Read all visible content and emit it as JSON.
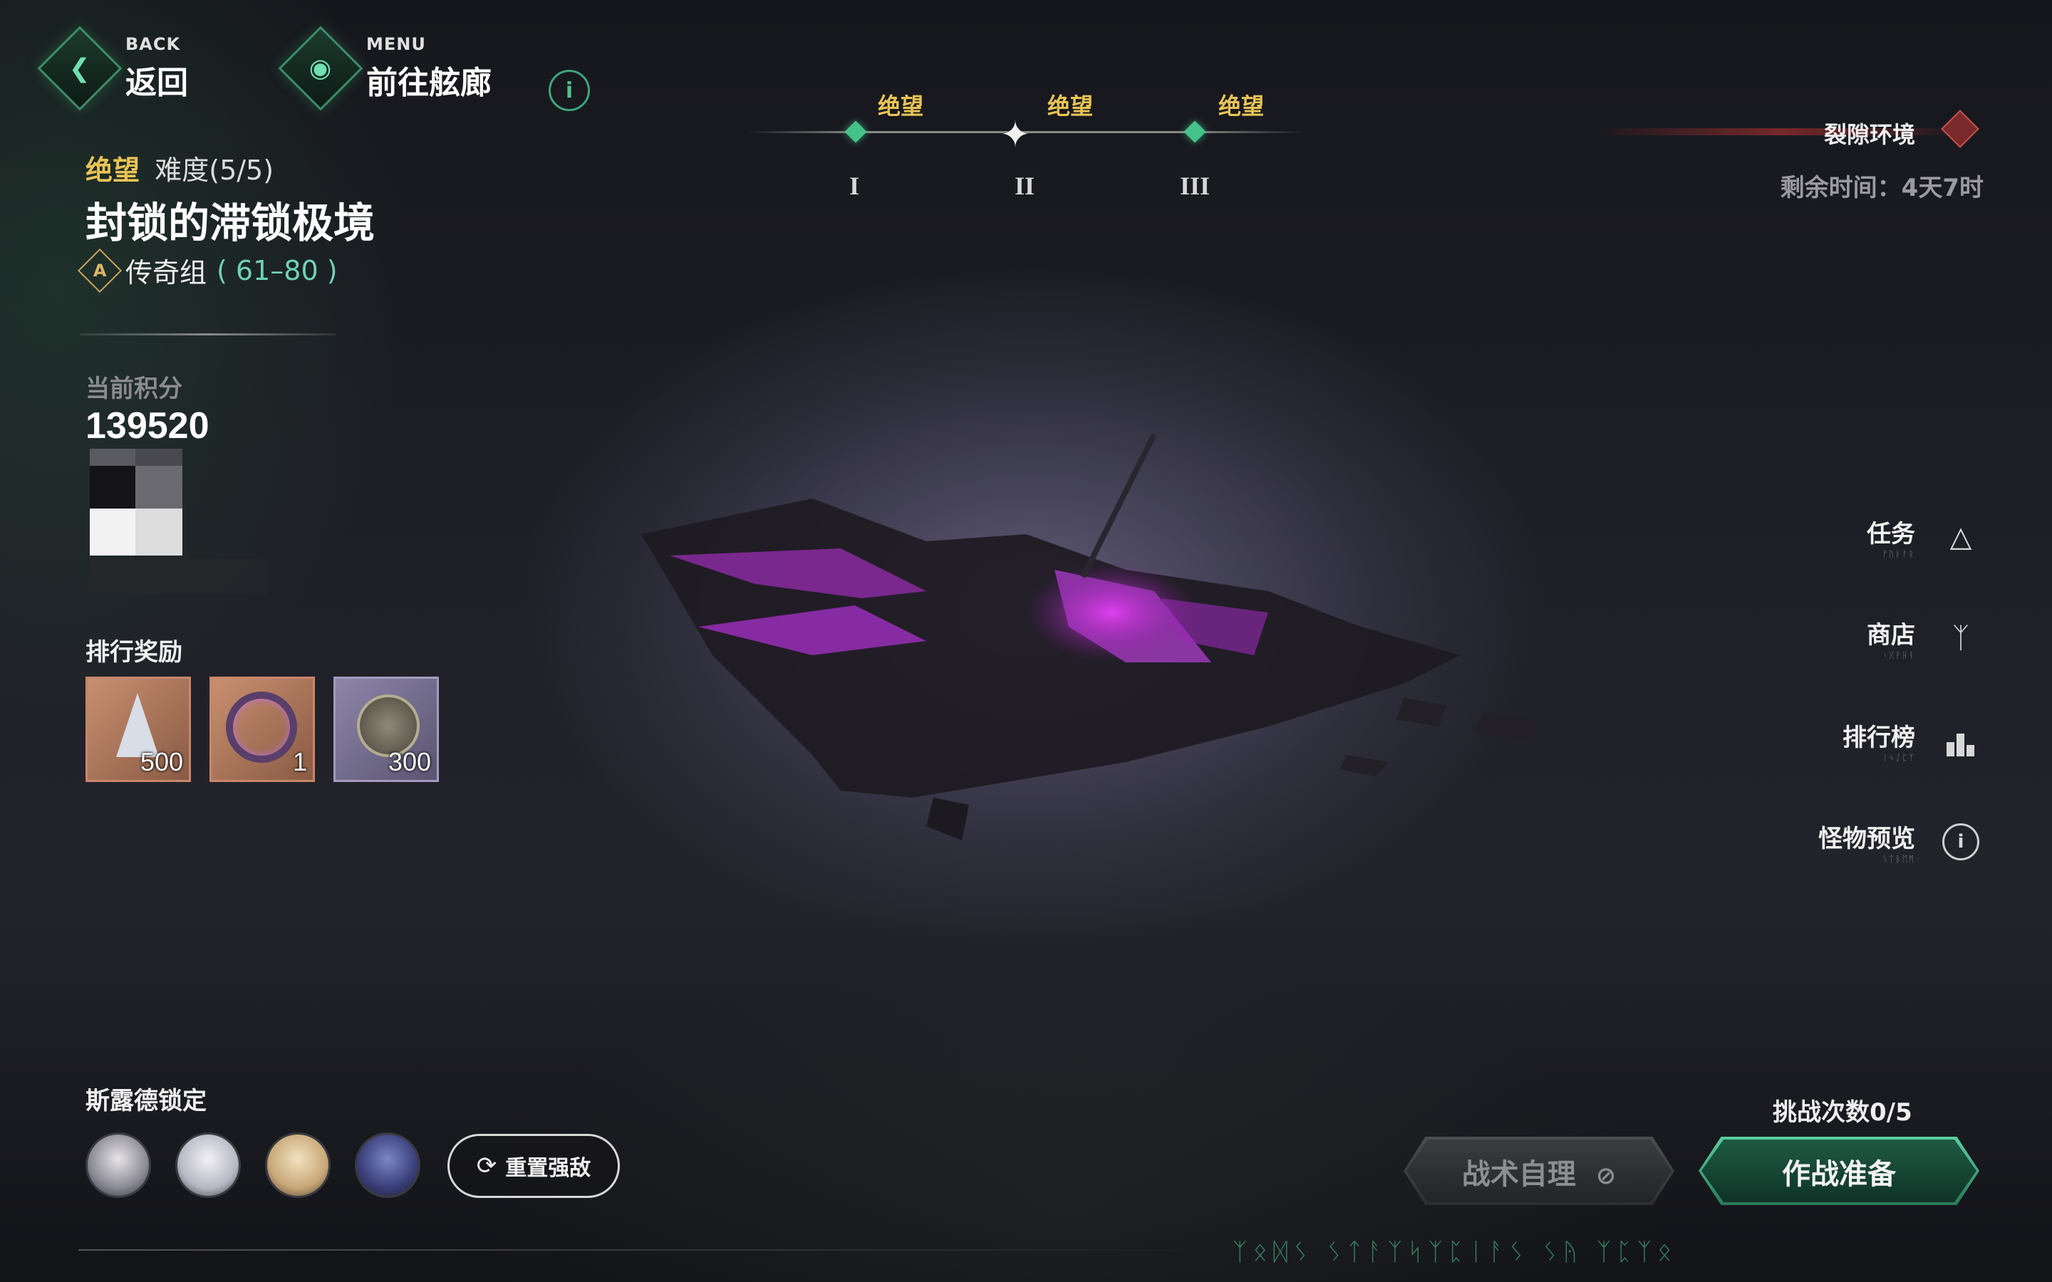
{
  "nav": {
    "back_small": "BACK",
    "back_label": "返回",
    "menu_small": "MENU",
    "menu_label": "前往舷廊"
  },
  "stage": {
    "tier_word": "绝望",
    "difficulty": "难度(5/5)",
    "title": "封锁的滞锁极境",
    "group_name": "传奇组",
    "group_range": "( 61–80 )",
    "badge_letter": "A"
  },
  "tiers": [
    {
      "label": "绝望",
      "numeral": "I"
    },
    {
      "label": "绝望",
      "numeral": "II"
    },
    {
      "label": "绝望",
      "numeral": "III"
    }
  ],
  "score": {
    "label": "当前积分",
    "value": "139520"
  },
  "rewards": {
    "title": "排行奖励",
    "items": [
      {
        "name": "crystal-reward",
        "qty": "500"
      },
      {
        "name": "ring-reward",
        "qty": "1"
      },
      {
        "name": "coin-reward",
        "qty": "300"
      }
    ]
  },
  "rift": {
    "label": "裂隙环境",
    "time": "剩余时间：4天7时"
  },
  "side_menu": [
    {
      "label": "任务",
      "sub": "ᚠᚢᚦᚨᚱ",
      "icon": "flask-icon"
    },
    {
      "label": "商店",
      "sub": "ᚲᚷᚹᚺᚾ",
      "icon": "shop-icon"
    },
    {
      "label": "排行榜",
      "sub": "ᛁᛃᛇᛈᛉ",
      "icon": "ranking-icon"
    },
    {
      "label": "怪物预览",
      "sub": "ᛊᛏᛒᛖᛗ",
      "icon": "info-icon"
    }
  ],
  "lock": {
    "title": "斯露德锁定",
    "reset_label": "重置强敌"
  },
  "challenge": {
    "count": "挑战次数0/5",
    "auto_label": "战术自理",
    "prepare_label": "作战准备"
  },
  "footer_runes": "ᛉᛟᛞᛊ ᛊᛏᚨᛉᛋᛉᛈᛁᚨᛊ ᛊᚤ ᛉᛈᛉᛟ"
}
